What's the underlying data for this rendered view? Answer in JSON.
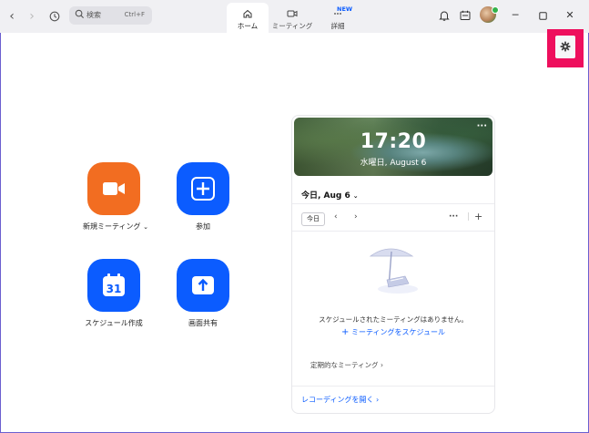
{
  "search": {
    "placeholder": "検索",
    "shortcut": "Ctrl+F"
  },
  "tabs": [
    {
      "label": "ホーム",
      "icon": "home-icon",
      "active": true
    },
    {
      "label": "ミーティング",
      "icon": "video-icon",
      "active": false
    },
    {
      "label": "詳細",
      "icon": "more-icon",
      "active": false,
      "badge": "NEW"
    }
  ],
  "actions": [
    {
      "label": "新規ミーティング",
      "icon": "camera-icon",
      "color": "#f26d21",
      "has_dropdown": true
    },
    {
      "label": "参加",
      "icon": "plus-icon",
      "color": "#0b5cff"
    },
    {
      "label": "スケジュール作成",
      "icon": "calendar-icon",
      "color": "#0b5cff",
      "calendar_number": "31"
    },
    {
      "label": "画面共有",
      "icon": "share-up-arrow-icon",
      "color": "#0b5cff"
    }
  ],
  "calendar": {
    "time": "17:20",
    "date": "水曜日, August 6",
    "day_selector": "今日, Aug 6",
    "today_button": "今日",
    "empty_message": "スケジュールされたミーティングはありません。",
    "schedule_link": "ミーティングをスケジュール",
    "recurring_label": "定期的なミーティング",
    "recordings_link": "レコーディングを開く"
  },
  "colors": {
    "accent": "#0b5cff",
    "orange": "#f26d21",
    "highlight": "#ee0f5d"
  }
}
